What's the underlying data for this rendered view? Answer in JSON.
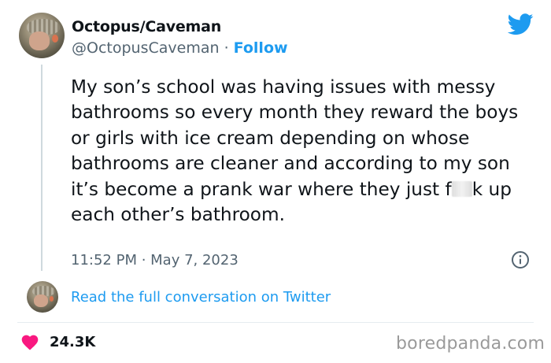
{
  "author": {
    "name": "Octopus/Caveman",
    "handle": "@OctopusCaveman",
    "separator": "·",
    "follow_label": "Follow"
  },
  "tweet": {
    "text_part1": "My son’s school was having issues with messy bathrooms so every month they reward the boys or girls with ice cream depending on whose bathrooms are cleaner and according to my son it’s become a prank war where they just f",
    "text_part2": "k up each other’s bathroom.",
    "timestamp": "11:52 PM · May 7, 2023"
  },
  "conversation_link": "Read the full conversation on Twitter",
  "likes": "24.3K",
  "watermark": "boredpanda.com",
  "icons": [
    "twitter-bird-icon",
    "info-icon",
    "heart-icon"
  ],
  "colors": {
    "brand_blue": "#1d9bf0",
    "heart_pink": "#f91880",
    "secondary_text": "#536471"
  }
}
